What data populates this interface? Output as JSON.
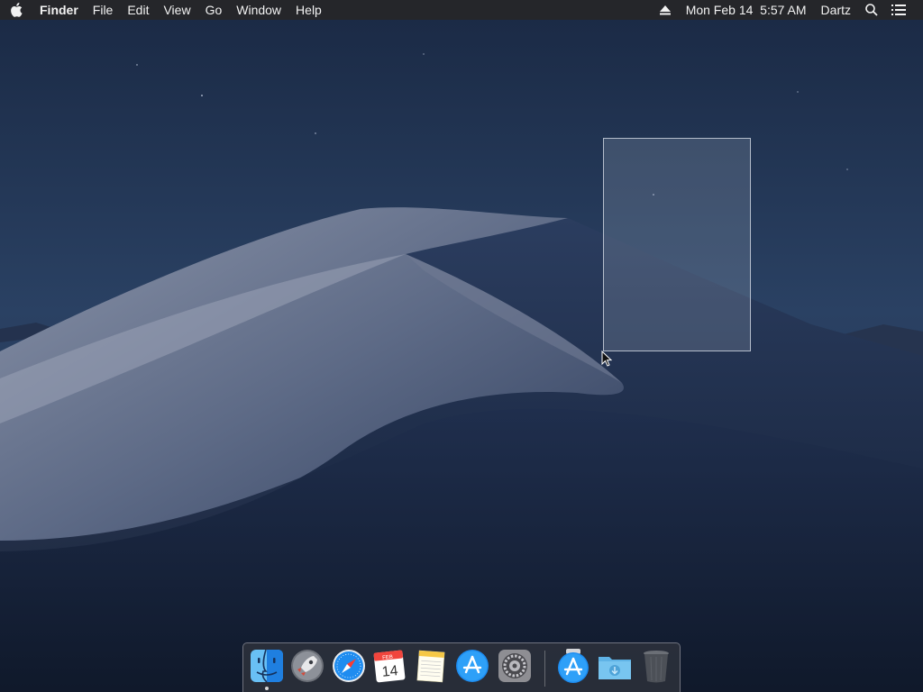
{
  "menubar": {
    "apple_icon": "apple-logo-icon",
    "app_name": "Finder",
    "items": [
      "File",
      "Edit",
      "View",
      "Go",
      "Window",
      "Help"
    ],
    "status": {
      "eject_icon": "eject-icon",
      "datetime": "Mon Feb 14  5:57 AM",
      "user": "Dartz",
      "search_icon": "spotlight-search-icon",
      "notification_icon": "notification-center-icon"
    }
  },
  "desktop": {
    "wallpaper": "mojave-dark-dunes",
    "selection_rectangle": true
  },
  "dock": {
    "apps": [
      {
        "name": "Finder",
        "icon": "finder-icon",
        "running": true
      },
      {
        "name": "Launchpad",
        "icon": "launchpad-icon",
        "running": false
      },
      {
        "name": "Safari",
        "icon": "safari-icon",
        "running": false
      },
      {
        "name": "Calendar",
        "icon": "calendar-icon",
        "month": "FEB",
        "day": "14",
        "running": false
      },
      {
        "name": "Notes",
        "icon": "notes-icon",
        "running": false
      },
      {
        "name": "App Store",
        "icon": "app-store-icon",
        "running": false
      },
      {
        "name": "System Preferences",
        "icon": "system-preferences-icon",
        "running": false
      }
    ],
    "others": [
      {
        "name": "Install App",
        "icon": "app-installer-icon"
      },
      {
        "name": "Downloads",
        "icon": "downloads-folder-icon"
      },
      {
        "name": "Trash",
        "icon": "trash-icon"
      }
    ]
  }
}
